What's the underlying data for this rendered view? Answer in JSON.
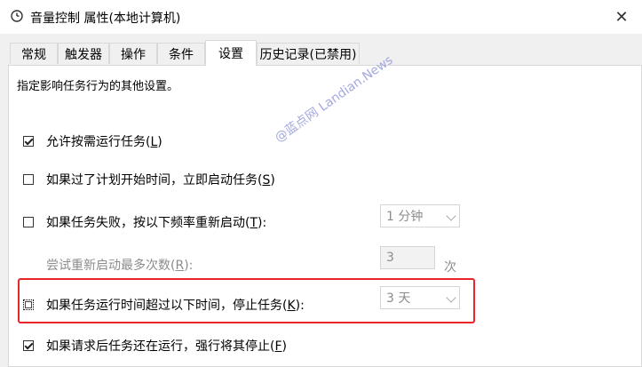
{
  "window": {
    "title": "音量控制 属性(本地计算机)",
    "close_label": "✕"
  },
  "tabs": [
    {
      "label": "常规",
      "active": false
    },
    {
      "label": "触发器",
      "active": false
    },
    {
      "label": "操作",
      "active": false
    },
    {
      "label": "条件",
      "active": false
    },
    {
      "label": "设置",
      "active": true
    },
    {
      "label": "历史记录(已禁用)",
      "active": false
    }
  ],
  "settings": {
    "description": "指定影响任务行为的其他设置。",
    "allow_on_demand": {
      "text": "允许按需运行任务(",
      "key": "L",
      "end": ")",
      "checked": true
    },
    "run_asap": {
      "text": "如果过了计划开始时间，立即启动任务(",
      "key": "S",
      "end": ")",
      "checked": false
    },
    "restart_on_fail": {
      "text": "如果任务失败，按以下频率重新启动(",
      "key": "T",
      "end": "):",
      "checked": false,
      "interval": "1 分钟"
    },
    "restart_attempts": {
      "text": "尝试重新启动最多次数(",
      "key": "R",
      "end": "):",
      "value": "3",
      "unit": "次"
    },
    "stop_if_longer": {
      "text": "如果任务运行时间超过以下时间，停止任务(",
      "key": "K",
      "end": "):",
      "checked": false,
      "duration": "3 天"
    },
    "force_stop": {
      "text": "如果请求后任务还在运行，强行将其停止(",
      "key": "F",
      "end": ")",
      "checked": true
    }
  },
  "watermark": "@蓝点网 Landian.News",
  "colors": {
    "highlight_border": "#e8262a",
    "disabled_text": "#8c8c8c",
    "watermark": "#9aa0dd"
  },
  "icons": {
    "window_icon": "clock-icon",
    "dropdown": "chevron-down-icon",
    "close": "close-icon"
  }
}
